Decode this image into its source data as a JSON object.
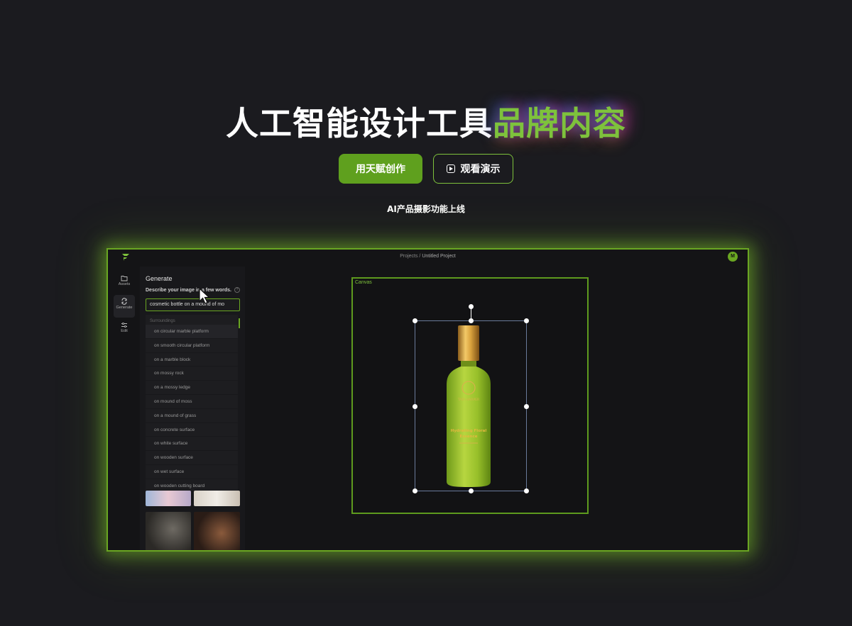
{
  "hero": {
    "title_main": "人工智能设计工具",
    "title_accent": "品牌内容",
    "primary_button": "用天赋创作",
    "secondary_button": "观看演示",
    "subline": "AI产品摄影功能上线"
  },
  "colors": {
    "background": "#1b1b1f",
    "accent": "#7ec23c",
    "button": "#5fa01e"
  },
  "app": {
    "breadcrumb_root": "Projects",
    "breadcrumb_separator": " / ",
    "breadcrumb_current": "Untitled Project",
    "avatar_initial": "M",
    "rail": [
      {
        "label": "Assets",
        "icon": "folder-icon"
      },
      {
        "label": "Generate",
        "icon": "refresh-icon"
      },
      {
        "label": "Edit",
        "icon": "sliders-icon"
      }
    ],
    "panel": {
      "title": "Generate",
      "description": "Describe your image in a few words.",
      "help": "?",
      "prompt_value": "cosmetic bottle on a mound of mo",
      "dropdown_heading": "Surroundings",
      "suggestions": [
        "on circular marble platform",
        "on smooth circular platform",
        "on a marble block",
        "on mossy rock",
        "on a mossy ledge",
        "on mound of moss",
        "on a mound of grass",
        "on concrete surface",
        "on white surface",
        "on wooden surface",
        "on wet surface",
        "on wooden cutting board"
      ]
    },
    "canvas": {
      "label": "Canvas",
      "product": {
        "brand": "TATA HARPER",
        "name_line1": "Hydrating Floral",
        "name_line2": "Essence"
      }
    }
  }
}
